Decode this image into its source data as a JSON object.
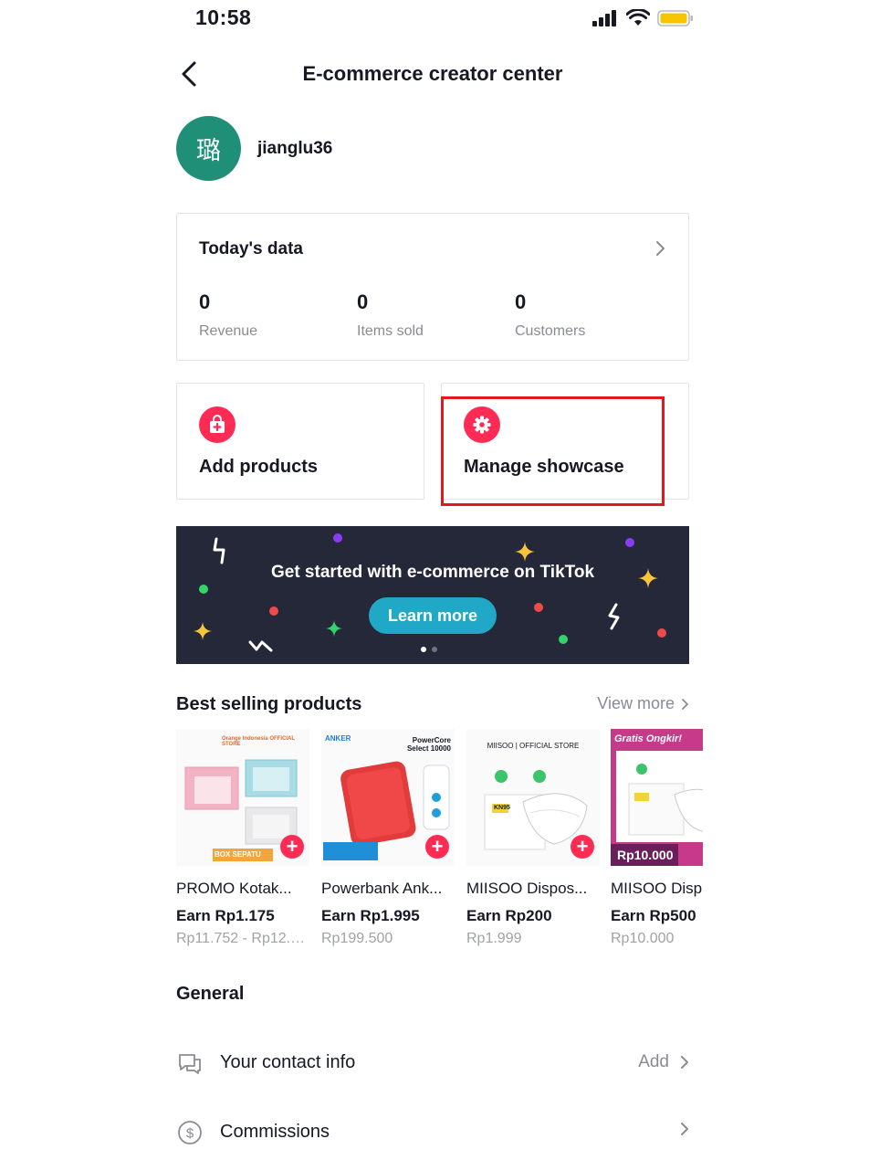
{
  "status_bar": {
    "time": "10:58"
  },
  "header": {
    "title": "E-commerce creator center"
  },
  "profile": {
    "avatar_char": "璐",
    "username": "jianglu36"
  },
  "today": {
    "title": "Today's data",
    "stats": [
      {
        "value": "0",
        "label": "Revenue"
      },
      {
        "value": "0",
        "label": "Items sold"
      },
      {
        "value": "0",
        "label": "Customers"
      }
    ]
  },
  "actions": [
    {
      "label": "Add products",
      "icon": "shopping-bag-plus-icon"
    },
    {
      "label": "Manage showcase",
      "icon": "gear-icon"
    }
  ],
  "banner": {
    "text": "Get started with e-commerce on TikTok",
    "button": "Learn more",
    "page_count": 2,
    "active_page": 1
  },
  "best_selling": {
    "title": "Best selling products",
    "view_more": "View more",
    "products": [
      {
        "name": "PROMO Kotak...",
        "earn": "Earn Rp1.175",
        "price": "Rp11.752 - Rp12.4...",
        "brand": "Orange Indonesia OFFICIAL STORE",
        "tag": "BOX SEPATU"
      },
      {
        "name": "Powerbank Ank...",
        "earn": "Earn Rp1.995",
        "price": "Rp199.500",
        "brand": "ANKER",
        "tag": "PowerCore Select 10000"
      },
      {
        "name": "MIISOO Dispos...",
        "earn": "Earn Rp200",
        "price": "Rp1.999",
        "brand": "MIISOO | OFFICIAL STORE",
        "tag": "KN95"
      },
      {
        "name": "MIISOO Disp",
        "earn": "Earn Rp500",
        "price": "Rp10.000",
        "brand": "Gratis Ongkir!",
        "tag": "Rp10.000"
      }
    ]
  },
  "general": {
    "title": "General",
    "rows": [
      {
        "label": "Your contact info",
        "right": "Add",
        "icon": "chat-bubble-icon"
      },
      {
        "label": "Commissions",
        "right": "",
        "icon": "dollar-circle-icon"
      }
    ]
  },
  "colors": {
    "accent": "#fe2c55",
    "banner_bg": "#252838",
    "learn_button": "#20a8c6",
    "avatar_bg": "#1f8f78",
    "highlight": "#e0191f"
  }
}
